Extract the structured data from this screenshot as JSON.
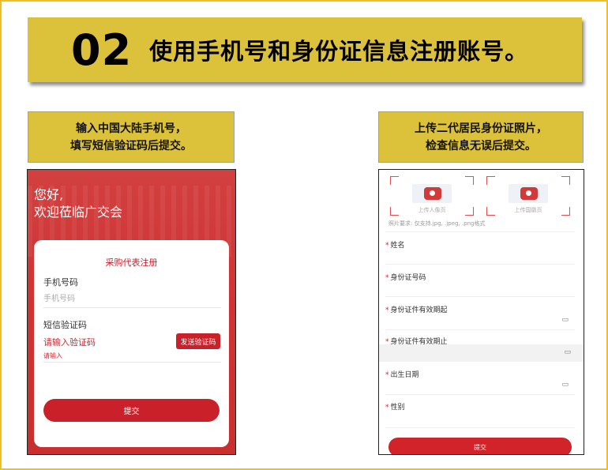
{
  "header": {
    "step_number": "02",
    "title": "使用手机号和身份证信息注册账号。"
  },
  "left_callout": {
    "line1": "输入中国大陆手机号，",
    "line2": "填写短信验证码后提交。"
  },
  "right_callout": {
    "line1": "上传二代居民身份证照片，",
    "line2": "检查信息无误后提交。"
  },
  "left_phone": {
    "greeting_line1": "您好,",
    "greeting_line2": "欢迎莅临广交会",
    "card_title": "采购代表注册",
    "phone_label": "手机号码",
    "phone_placeholder": "手机号码",
    "sms_label": "短信验证码",
    "sms_placeholder": "请输入验证码",
    "send_code_button": "发送验证码",
    "sms_error": "请输入",
    "submit_button": "提交"
  },
  "right_phone": {
    "upload_portrait_caption": "上传人像页",
    "upload_emblem_caption": "上传国徽页",
    "photo_requirement": "照片要求: 仅支持.jpg, .jpeg, .png格式",
    "required_mark": "*",
    "fields": {
      "name": "姓名",
      "id_number": "身份证号码",
      "valid_from": "身份证件有效期起",
      "valid_to": "身份证件有效期止",
      "birth_date": "出生日期",
      "gender": "性别"
    },
    "calendar_glyph": "▭",
    "submit_button": "提交"
  }
}
